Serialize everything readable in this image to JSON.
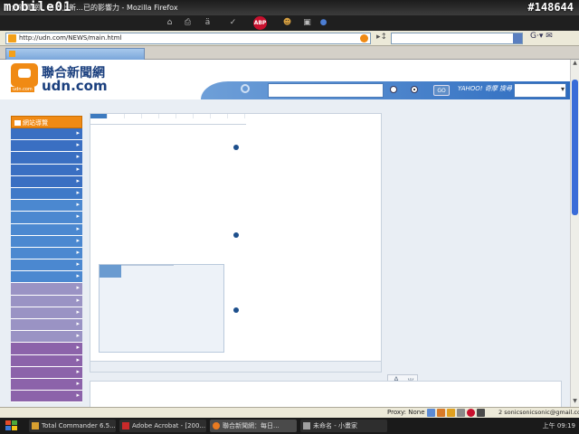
{
  "watermark": {
    "left": "mobile01",
    "right": "#148644"
  },
  "window": {
    "title": "聯合新聞網：每日上新…已的影響力 - Mozilla Firefox"
  },
  "toolbar": {
    "icons": [
      "home-icon",
      "print-icon",
      "font-size-icon",
      "spellcheck-icon",
      "adblock-plus-icon",
      "user-icon",
      "trash-icon",
      "dropdown-icon"
    ],
    "abp_label": "ABP"
  },
  "address": {
    "url": "http://udn.com/NEWS/main.html"
  },
  "tab": {
    "label": ""
  },
  "site": {
    "logo_zh": "聯合新聞網",
    "logo_en": "udn.com",
    "logo_sub": "udn.com",
    "search_go": "GO",
    "yahoo_label": "YAHOO! 奇摩 搜尋",
    "nav_header": "網站導覽"
  },
  "fontsize": {
    "a": "A",
    "b": "半"
  },
  "status": {
    "proxy": "Proxy: None",
    "email": "2 sonicsonicsonic@gmail.com"
  },
  "taskbar": {
    "tasks": [
      "Total Commander 6.5...",
      "Adobe Acrobat - [200...",
      "聯合新聞網：每日...",
      "未命名 - 小畫家"
    ],
    "clock": "上午 09:19"
  },
  "colors": {
    "nav": [
      "#3a6fc2",
      "#3a6fc2",
      "#3a6fc2",
      "#3a6fc2",
      "#3a6fc2",
      "#3f79c8",
      "#4b88d0",
      "#4b88d0",
      "#4b88d0",
      "#4b88d0",
      "#4b88d0",
      "#4b88d0",
      "#4b88d0",
      "#9a93c4",
      "#9a93c4",
      "#9a93c4",
      "#9a93c4",
      "#9a93c4",
      "#8c63aa",
      "#8c63aa",
      "#8c63aa",
      "#8c63aa",
      "#8c63aa"
    ]
  }
}
